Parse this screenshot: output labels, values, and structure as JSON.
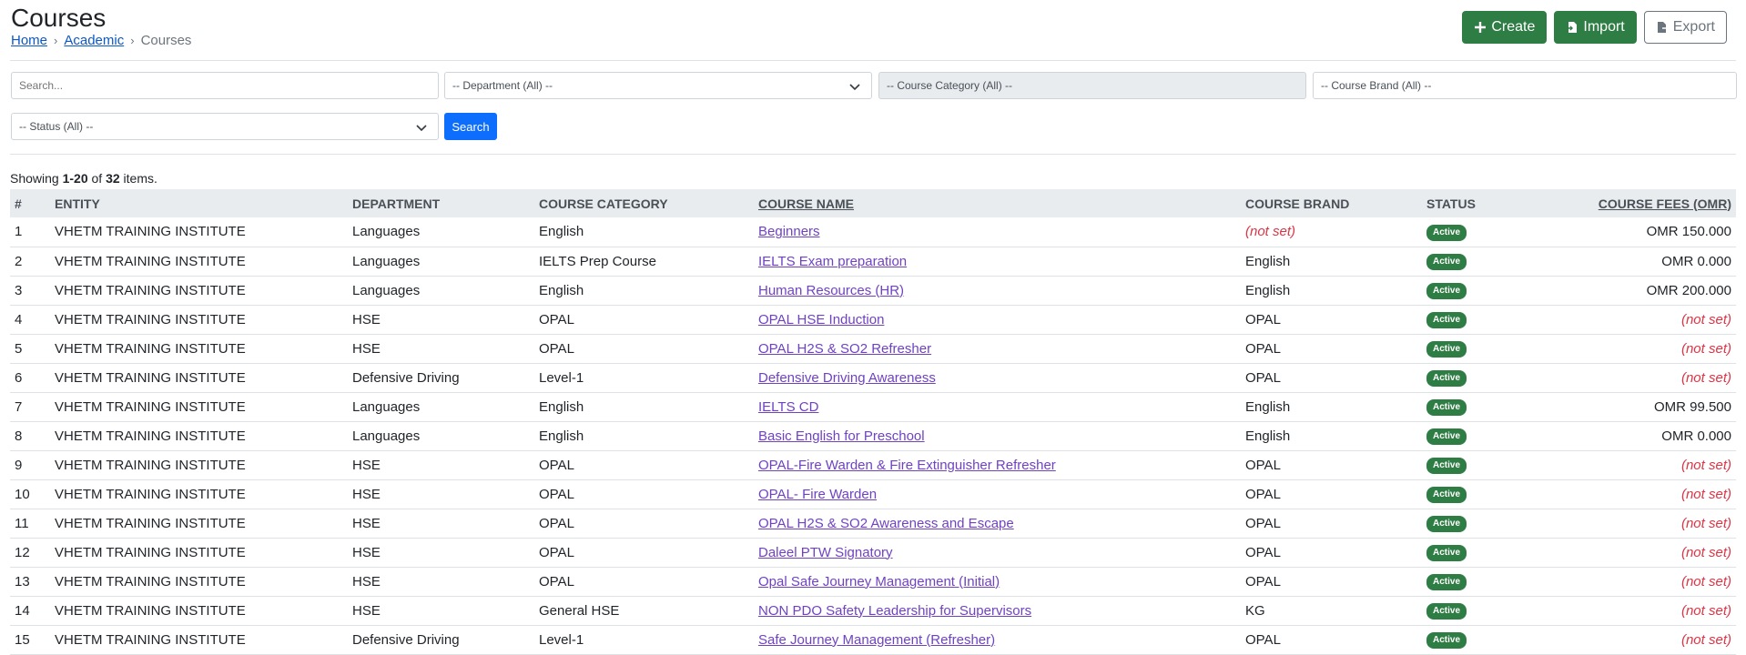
{
  "page": {
    "title": "Courses",
    "breadcrumb": {
      "home": "Home",
      "academic": "Academic",
      "current": "Courses",
      "separator": "›"
    }
  },
  "actions": {
    "create": "Create",
    "import": "Import",
    "export": "Export"
  },
  "filters": {
    "search_placeholder": "Search...",
    "department": "-- Department (All) --",
    "course_category": "-- Course Category (All) --",
    "course_brand": "-- Course Brand (All) --",
    "status": "-- Status (All) --",
    "search_button": "Search"
  },
  "summary": {
    "prefix": "Showing ",
    "range": "1-20",
    "mid": " of ",
    "total": "32",
    "suffix": " items."
  },
  "table": {
    "headers": {
      "num": "#",
      "entity": "Entity",
      "department": "Department",
      "course_category": "Course Category",
      "course_name": "Course Name",
      "course_brand": "Course Brand",
      "status": "Status",
      "course_fees": "Course Fees (OMR)"
    },
    "rows": [
      {
        "num": "1",
        "entity": "VHETM TRAINING INSTITUTE",
        "department": "Languages",
        "category": "English",
        "name": "Beginners",
        "brand": "(not set)",
        "status": "Active",
        "fees": "OMR 150.000"
      },
      {
        "num": "2",
        "entity": "VHETM TRAINING INSTITUTE",
        "department": "Languages",
        "category": "IELTS Prep Course",
        "name": "IELTS Exam preparation",
        "brand": "English",
        "status": "Active",
        "fees": "OMR 0.000"
      },
      {
        "num": "3",
        "entity": "VHETM TRAINING INSTITUTE",
        "department": "Languages",
        "category": "English",
        "name": "Human Resources (HR)",
        "brand": "English",
        "status": "Active",
        "fees": "OMR 200.000"
      },
      {
        "num": "4",
        "entity": "VHETM TRAINING INSTITUTE",
        "department": "HSE",
        "category": "OPAL",
        "name": "OPAL HSE Induction",
        "brand": "OPAL",
        "status": "Active",
        "fees": "(not set)"
      },
      {
        "num": "5",
        "entity": "VHETM TRAINING INSTITUTE",
        "department": "HSE",
        "category": "OPAL",
        "name": "OPAL H2S & SO2 Refresher",
        "brand": "OPAL",
        "status": "Active",
        "fees": "(not set)"
      },
      {
        "num": "6",
        "entity": "VHETM TRAINING INSTITUTE",
        "department": "Defensive Driving",
        "category": "Level-1",
        "name": "Defensive Driving Awareness",
        "brand": "OPAL",
        "status": "Active",
        "fees": "(not set)"
      },
      {
        "num": "7",
        "entity": "VHETM TRAINING INSTITUTE",
        "department": "Languages",
        "category": "English",
        "name": "IELTS CD",
        "brand": "English",
        "status": "Active",
        "fees": "OMR 99.500"
      },
      {
        "num": "8",
        "entity": "VHETM TRAINING INSTITUTE",
        "department": "Languages",
        "category": "English",
        "name": "Basic English for Preschool",
        "brand": "English",
        "status": "Active",
        "fees": "OMR 0.000"
      },
      {
        "num": "9",
        "entity": "VHETM TRAINING INSTITUTE",
        "department": "HSE",
        "category": "OPAL",
        "name": "OPAL-Fire Warden & Fire Extinguisher Refresher",
        "brand": "OPAL",
        "status": "Active",
        "fees": "(not set)"
      },
      {
        "num": "10",
        "entity": "VHETM TRAINING INSTITUTE",
        "department": "HSE",
        "category": "OPAL",
        "name": "OPAL- Fire Warden",
        "brand": "OPAL",
        "status": "Active",
        "fees": "(not set)"
      },
      {
        "num": "11",
        "entity": "VHETM TRAINING INSTITUTE",
        "department": "HSE",
        "category": "OPAL",
        "name": "OPAL H2S & SO2 Awareness and Escape",
        "brand": "OPAL",
        "status": "Active",
        "fees": "(not set)"
      },
      {
        "num": "12",
        "entity": "VHETM TRAINING INSTITUTE",
        "department": "HSE",
        "category": "OPAL",
        "name": "Daleel PTW Signatory",
        "brand": "OPAL",
        "status": "Active",
        "fees": "(not set)"
      },
      {
        "num": "13",
        "entity": "VHETM TRAINING INSTITUTE",
        "department": "HSE",
        "category": "OPAL",
        "name": "Opal Safe Journey Management (Initial)",
        "brand": "OPAL",
        "status": "Active",
        "fees": "(not set)"
      },
      {
        "num": "14",
        "entity": "VHETM TRAINING INSTITUTE",
        "department": "HSE",
        "category": "General HSE",
        "name": "NON PDO Safety Leadership for Supervisors",
        "brand": "KG",
        "status": "Active",
        "fees": "(not set)"
      },
      {
        "num": "15",
        "entity": "VHETM TRAINING INSTITUTE",
        "department": "Defensive Driving",
        "category": "Level-1",
        "name": "Safe Journey Management (Refresher)",
        "brand": "OPAL",
        "status": "Active",
        "fees": "(not set)"
      }
    ]
  },
  "colors": {
    "success": "#2e7d44",
    "primary": "#0d6efd",
    "link": "#6f42c1",
    "danger": "#dc3545"
  }
}
